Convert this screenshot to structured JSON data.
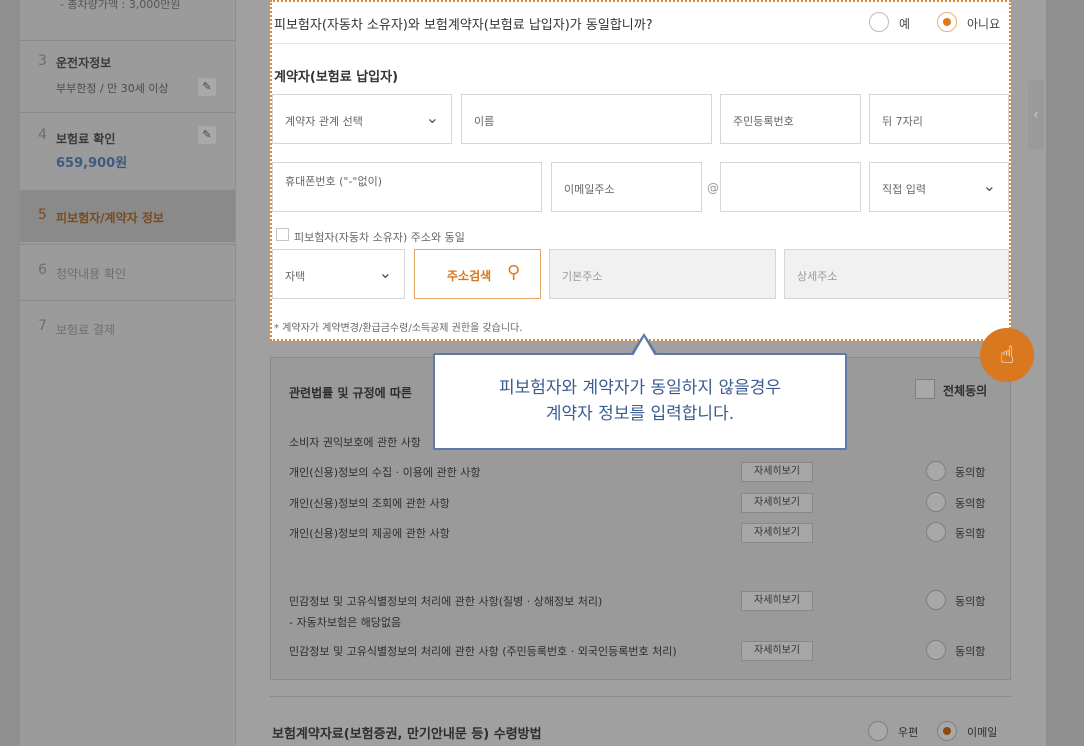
{
  "sidebar": {
    "top_sub": "- 총차량가액 : 3,000만원",
    "steps": [
      {
        "num": "3",
        "title": "운전자정보",
        "desc": "부부한정 / 만 30세 이상"
      },
      {
        "num": "4",
        "title": "보험료 확인",
        "amount": "659,900원"
      },
      {
        "num": "5",
        "title": "피보험자/계약자 정보"
      },
      {
        "num": "6",
        "title": "청약내용 확인"
      },
      {
        "num": "7",
        "title": "보험료 결제"
      }
    ],
    "pencil_glyph": "✎"
  },
  "question": {
    "text": "피보험자(자동차 소유자)와 보험계약자(보험료 납입자)가 동일합니까?",
    "yes": "예",
    "no": "아니요"
  },
  "contractor": {
    "section_title": "계약자(보험료 납입자)",
    "relation_select": "계약자 관계 선택",
    "name_placeholder": "이름",
    "rrn_front": "주민등록번호",
    "rrn_back": "뒤 7자리",
    "mobile_placeholder": "휴대폰번호 (\"-\"없이)",
    "email_placeholder": "이메일주소",
    "at_sign": "@",
    "email_domain_select": "직접 입력",
    "same_address_label": "피보험자(자동차 소유자) 주소와 동일",
    "address_type": "자택",
    "address_search": "주소검색",
    "base_address": "기본주소",
    "detail_address": "상세주소",
    "note": "* 계약자가 계약변경/환급금수령/소득공제 권한을 갖습니다."
  },
  "tooltip": {
    "line1": "피보험자와 계약자가 동일하지 않을경우",
    "line2": "계약자 정보를 입력합니다."
  },
  "consent": {
    "header": "관련법률 및 규정에 따른",
    "all_agree": "전체동의",
    "subheader": "소비자 권익보호에 관한 사항",
    "items": [
      {
        "text": "개인(신용)정보의 수집 · 이용에 관한 사항",
        "detail": "자세히보기",
        "agree": "동의함"
      },
      {
        "text": "개인(신용)정보의 조회에 관한 사항",
        "detail": "자세히보기",
        "agree": "동의함"
      },
      {
        "text": "개인(신용)정보의 제공에 관한 사항",
        "detail": "자세히보기",
        "agree": "동의함"
      },
      {
        "text": "민감정보 및 고유식별정보의 처리에 관한 사항(질병 · 상해정보 처리)",
        "sub": "- 자동차보험은 해당없음",
        "detail": "자세히보기",
        "agree": "동의함"
      },
      {
        "text": "민감정보 및 고유식별정보의 처리에 관한 사항 (주민등록번호 · 외국인등록번호 처리)",
        "detail": "자세히보기",
        "agree": "동의함"
      }
    ]
  },
  "receipt": {
    "title": "보험계약자료(보험증권, 만기안내문 등) 수령방법",
    "option_mail": "우편",
    "option_email": "이메일"
  },
  "icons": {
    "chevron": "⌄",
    "search": "⚲",
    "tap": "☝",
    "collapse": "‹"
  },
  "colors": {
    "accent_orange": "#e07a1c",
    "tooltip_blue": "#5b7aa8"
  }
}
